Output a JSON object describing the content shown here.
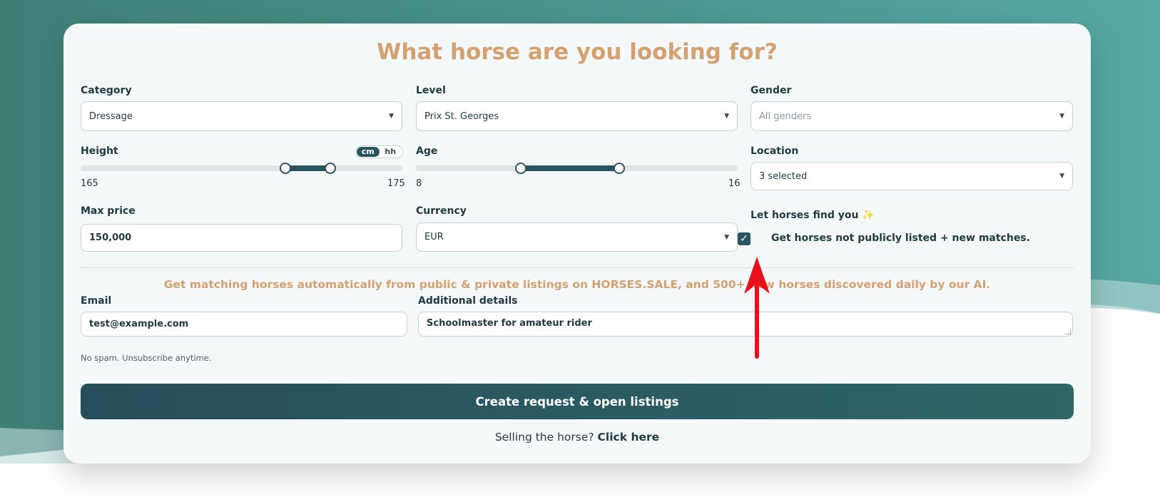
{
  "form": {
    "title": "What horse are you looking for?",
    "category": {
      "label": "Category",
      "value": "Dressage"
    },
    "level": {
      "label": "Level",
      "value": "Prix St. Georges"
    },
    "gender": {
      "label": "Gender",
      "placeholder": "All genders"
    },
    "height": {
      "label": "Height",
      "min": "165",
      "max": "175",
      "unit_cm": "cm",
      "unit_hh": "hh"
    },
    "age": {
      "label": "Age",
      "min": "8",
      "max": "16"
    },
    "location": {
      "label": "Location",
      "value": "3 selected"
    },
    "max_price": {
      "label": "Max price",
      "value": "150,000"
    },
    "currency": {
      "label": "Currency",
      "value": "EUR"
    },
    "let_horses_find_you": {
      "label": "Let horses find you",
      "checkbox_label": "Get horses not publicly listed + new matches.",
      "checked": true
    },
    "promo": "Get matching horses automatically from public & private listings on HORSES.SALE, and 500+ new horses discovered daily by our AI.",
    "email": {
      "label": "Email",
      "value": "test@example.com",
      "hint": "No spam. Unsubscribe anytime."
    },
    "additional": {
      "label": "Additional details",
      "value": "Schoolmaster for amateur rider"
    },
    "submit_label": "Create request & open listings",
    "selling_prefix": "Selling the horse?",
    "selling_link": "Click here"
  },
  "colors": {
    "accent": "#d4a171",
    "primary": "#2a5560",
    "annotation": "#e8101a"
  },
  "icons": {
    "sparkle": "sparkle-icon",
    "caret": "chevron-down-icon",
    "check": "check-icon"
  }
}
